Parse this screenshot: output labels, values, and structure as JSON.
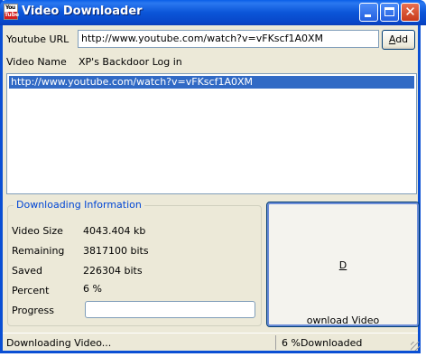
{
  "window": {
    "title": "Video Downloader",
    "icon": "youtube-icon",
    "icon_text_top": "You",
    "icon_text_bottom": "Tube",
    "controls": [
      "minimize-icon",
      "maximize-icon",
      "close-icon"
    ],
    "close_glyph": "✕"
  },
  "form": {
    "url_label": "Youtube URL",
    "url_value": "http://www.youtube.com/watch?v=vFKscf1A0XM",
    "add_button": "Add",
    "add_button_accel": "A",
    "add_button_rest": "dd",
    "name_label": "Video Name",
    "name_value": "XP's Backdoor Log in"
  },
  "queue": {
    "items": [
      "http://www.youtube.com/watch?v=vFKscf1A0XM"
    ]
  },
  "info": {
    "group_title": "Downloading Information",
    "size_label": "Video Size",
    "size_value": "4043.404 kb",
    "remaining_label": "Remaining",
    "remaining_value": "3817100 bits",
    "saved_label": "Saved",
    "saved_value": "226304 bits",
    "percent_label": "Percent",
    "percent_value": "6 %",
    "progress_label": "Progress",
    "progress_fraction": 0.0
  },
  "download_button": {
    "label": "Download Video",
    "accel": "D",
    "rest": "ownload Video"
  },
  "status": {
    "left": "Downloading Video...",
    "right": "6 %Downloaded"
  },
  "colors": {
    "titlebar": "#0a5fe8",
    "selection": "#316ac5",
    "group_title": "#0046d5",
    "face": "#ece9d8"
  }
}
